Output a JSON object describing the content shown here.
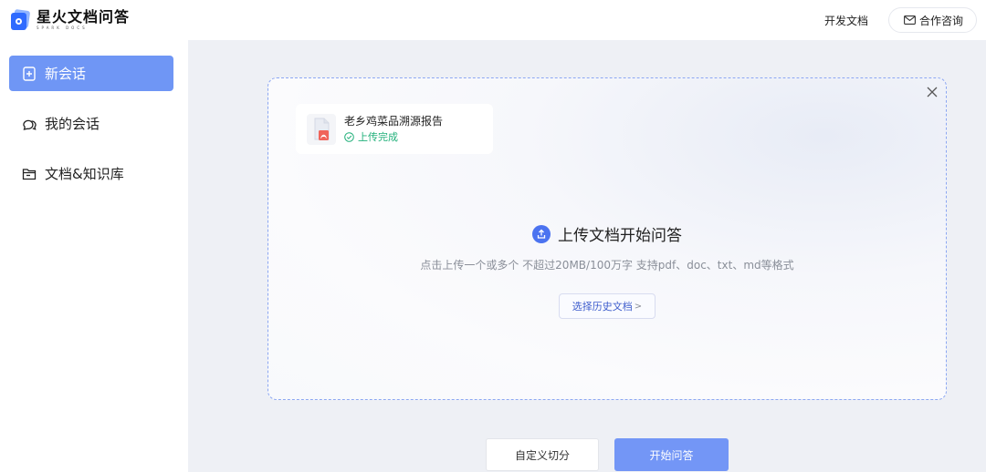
{
  "header": {
    "logo_title": "星火文档问答",
    "logo_sub": "SPARK DOCS",
    "dev_docs_label": "开发文档",
    "contact_label": "合作咨询"
  },
  "sidebar": {
    "items": [
      {
        "label": "新会话",
        "icon": "add-doc-icon",
        "active": true
      },
      {
        "label": "我的会话",
        "icon": "chat-bubbles-icon",
        "active": false
      },
      {
        "label": "文档&知识库",
        "icon": "folder-icon",
        "active": false
      }
    ]
  },
  "upload": {
    "file": {
      "name": "老乡鸡菜品溯源报告",
      "status": "上传完成",
      "type_icon": "pdf-icon"
    },
    "title": "上传文档开始问答",
    "hint": "点击上传一个或多个 不超过20MB/100万字 支持pdf、doc、txt、md等格式",
    "history_label": "选择历史文档",
    "history_chevron": ">"
  },
  "actions": {
    "custom_split_label": "自定义切分",
    "start_label": "开始问答"
  },
  "colors": {
    "accent": "#6f96f5",
    "primary_button": "#7396f6",
    "success": "#21b07a",
    "pdf": "#f0645a"
  }
}
